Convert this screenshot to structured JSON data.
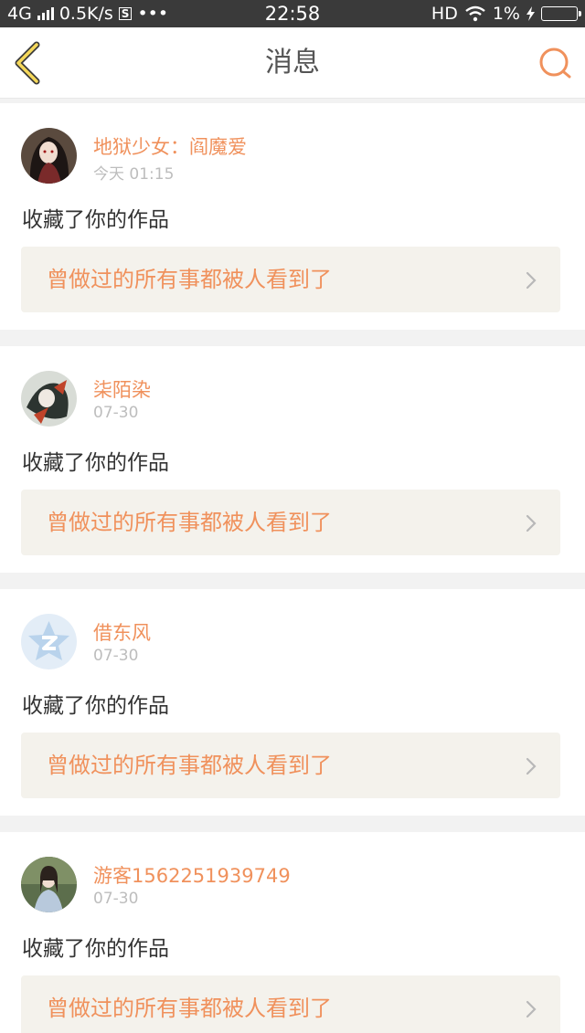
{
  "status_bar": {
    "network": "4G",
    "speed": "0.5K/s",
    "s_badge": "S",
    "more": "•••",
    "time": "22:58",
    "hd": "HD",
    "battery": "1%"
  },
  "header": {
    "title": "消息",
    "back_icon": "chevron-left-icon",
    "search_icon": "search-icon"
  },
  "colors": {
    "accent": "#f0915c",
    "work_bg": "#f4f2ec",
    "page_bg": "#f2f2f2"
  },
  "messages": [
    {
      "user": "地狱少女：阎魔爱",
      "time": "今天 01:15",
      "action": "收藏了你的作品",
      "work_title": "曾做过的所有事都被人看到了",
      "avatar": "anime-girl-avatar"
    },
    {
      "user": "柒陌染",
      "time": "07-30",
      "action": "收藏了你的作品",
      "work_title": "曾做过的所有事都被人看到了",
      "avatar": "anime-character-avatar"
    },
    {
      "user": "借东风",
      "time": "07-30",
      "action": "收藏了你的作品",
      "work_title": "曾做过的所有事都被人看到了",
      "avatar": "default-qq-avatar"
    },
    {
      "user": "游客1562251939749",
      "time": "07-30",
      "action": "收藏了你的作品",
      "work_title": "曾做过的所有事都被人看到了",
      "avatar": "photo-avatar"
    }
  ]
}
